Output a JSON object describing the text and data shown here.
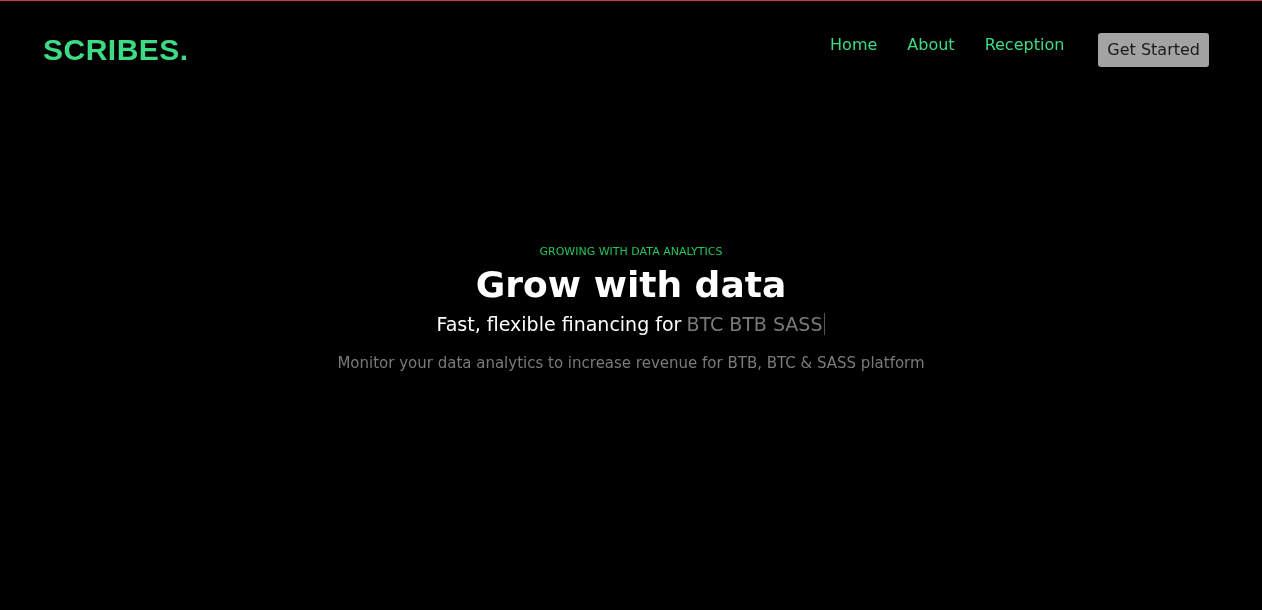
{
  "navbar": {
    "logo": "SCRIBES.",
    "links": [
      "Home",
      "About",
      "Reception"
    ],
    "cta": "Get Started"
  },
  "hero": {
    "eyebrow": "GROWING WITH DATA ANALYTICS",
    "title": "Grow with data",
    "tagline": "Fast, flexible financing for",
    "typed_text": "BTC BTB SASS",
    "description": "Monitor your data analytics to increase revenue for BTB, BTC & SASS platform"
  }
}
